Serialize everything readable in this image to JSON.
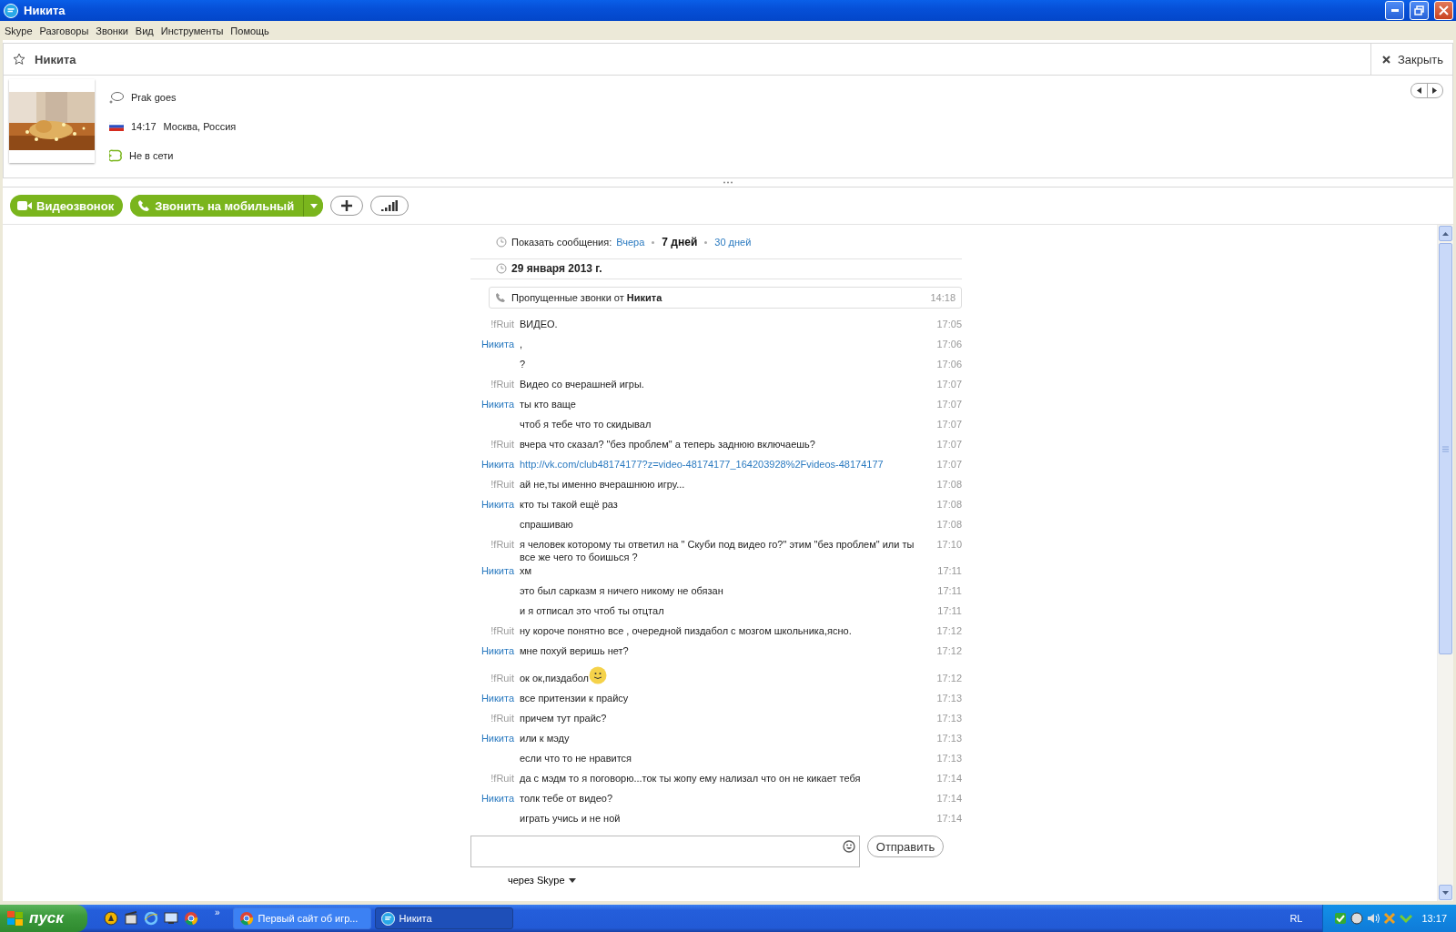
{
  "window": {
    "title": "Никита"
  },
  "menu": [
    "Skype",
    "Разговоры",
    "Звонки",
    "Вид",
    "Инструменты",
    "Помощь"
  ],
  "contact": {
    "name": "Никита",
    "favorite": false,
    "close_label": "Закрыть",
    "mood": "Prak goes",
    "local_time": "14:17",
    "location": "Москва, Россия",
    "status": "Не в сети"
  },
  "toolbar": {
    "video_call": "Видеозвонок",
    "call_mobile": "Звонить на мобильный"
  },
  "history": {
    "label": "Показать сообщения:",
    "options": [
      {
        "label": "Вчера",
        "selected": false
      },
      {
        "label": "7 дней",
        "selected": true
      },
      {
        "label": "30 дней",
        "selected": false
      }
    ]
  },
  "date": "29 января 2013 г.",
  "missed_call": {
    "text": "Пропущенные звонки от **Никита**",
    "time": "14:18"
  },
  "messages": [
    {
      "sender": "!fRuit",
      "outgoing": true,
      "text": "ВИДЕО.",
      "time": "17:05"
    },
    {
      "sender": "Никита",
      "outgoing": false,
      "text": ",",
      "time": "17:06"
    },
    {
      "text": "?",
      "time": "17:06"
    },
    {
      "sender": "!fRuit",
      "outgoing": true,
      "text": "Видео со вчерашней игры.",
      "time": "17:07"
    },
    {
      "sender": "Никита",
      "outgoing": false,
      "text": "ты кто ваще",
      "time": "17:07"
    },
    {
      "text": "чтоб я тебе что то скидывал",
      "time": "17:07"
    },
    {
      "sender": "!fRuit",
      "outgoing": true,
      "text": "вчера что сказал? \"без проблем\" а теперь заднюю включаешь?",
      "time": "17:07"
    },
    {
      "sender": "Никита",
      "outgoing": false,
      "kind": "link",
      "text": "http://vk.com/club48174177?z=video-48174177_164203928%2Fvideos-48174177",
      "time": "17:07"
    },
    {
      "sender": "!fRuit",
      "outgoing": true,
      "text": "ай не,ты именно вчерашнюю игру...",
      "time": "17:08"
    },
    {
      "sender": "Никита",
      "outgoing": false,
      "text": "кто ты такой ещё раз",
      "time": "17:08"
    },
    {
      "text": "спрашиваю",
      "time": "17:08"
    },
    {
      "sender": "!fRuit",
      "outgoing": true,
      "text": "я человек которому ты ответил на \" Скуби под видео го?\" этим \"без проблем\" или ты все же чего то боишься ?",
      "time": "17:10"
    },
    {
      "sender": "Никита",
      "outgoing": false,
      "text": "хм",
      "time": "17:11"
    },
    {
      "text": "это был сарказм я ничего никому не обязан",
      "time": "17:11"
    },
    {
      "text": "и я отписал это чтоб ты отцтал",
      "time": "17:11"
    },
    {
      "sender": "!fRuit",
      "outgoing": true,
      "text": "ну короче понятно все , очередной пиздабол с мозгом школьника,ясно.",
      "time": "17:12"
    },
    {
      "sender": "Никита",
      "outgoing": false,
      "text": "мне похуй веришь нет?",
      "time": "17:12"
    },
    {
      "sender": "!fRuit",
      "outgoing": true,
      "text": "ок ок,пиздабол",
      "emoji": true,
      "time": "17:12"
    },
    {
      "sender": "Никита",
      "outgoing": false,
      "text": "все притензии к прайсу",
      "time": "17:13"
    },
    {
      "sender": "!fRuit",
      "outgoing": true,
      "text": "причем тут прайс?",
      "time": "17:13"
    },
    {
      "sender": "Никита",
      "outgoing": false,
      "text": "или к мэду",
      "time": "17:13"
    },
    {
      "text": "если что то не нравится",
      "time": "17:13"
    },
    {
      "sender": "!fRuit",
      "outgoing": true,
      "text": "да с мэдм то я поговорю...ток ты жопу ему нализал что он не кикает тебя",
      "time": "17:14"
    },
    {
      "sender": "Никита",
      "outgoing": false,
      "text": "толк тебе от видео?",
      "time": "17:14"
    },
    {
      "text": "играть учись и не ной",
      "time": "17:14"
    }
  ],
  "composer": {
    "send": "Отправить",
    "via": "через Skype"
  },
  "taskbar": {
    "start": "пуск",
    "chevron": "»",
    "tasks": [
      {
        "label": "Первый сайт об игр...",
        "selected": false
      },
      {
        "label": "Никита",
        "selected": true
      }
    ],
    "language": "RL",
    "clock": "13:17"
  }
}
